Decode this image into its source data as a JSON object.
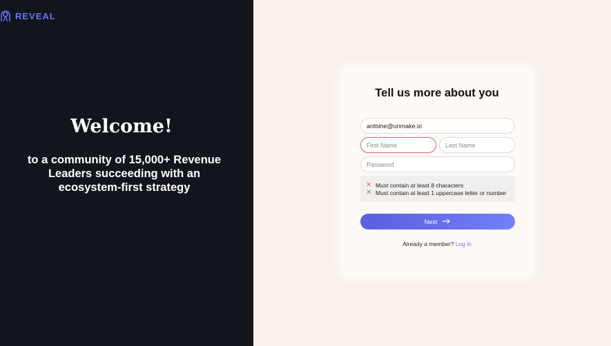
{
  "brand": {
    "name": "REVEAL",
    "accent": "#6a73f2"
  },
  "left": {
    "welcome": "Welcome!",
    "tagline": "to a community of 15,000+ Revenue Leaders succeeding with an ecosystem-first strategy"
  },
  "form": {
    "title": "Tell us more about you",
    "email_value": "antoine@unmake.io",
    "first_name_placeholder": "First Name",
    "last_name_placeholder": "Last Name",
    "password_placeholder": "Password",
    "rules": [
      "Must contain at least 8 characters",
      "Must contain at least 1 uppercase letter or number"
    ],
    "next_label": "Next",
    "already_member": "Already a member?",
    "login_label": "Log in",
    "error_color": "#d8627a"
  }
}
